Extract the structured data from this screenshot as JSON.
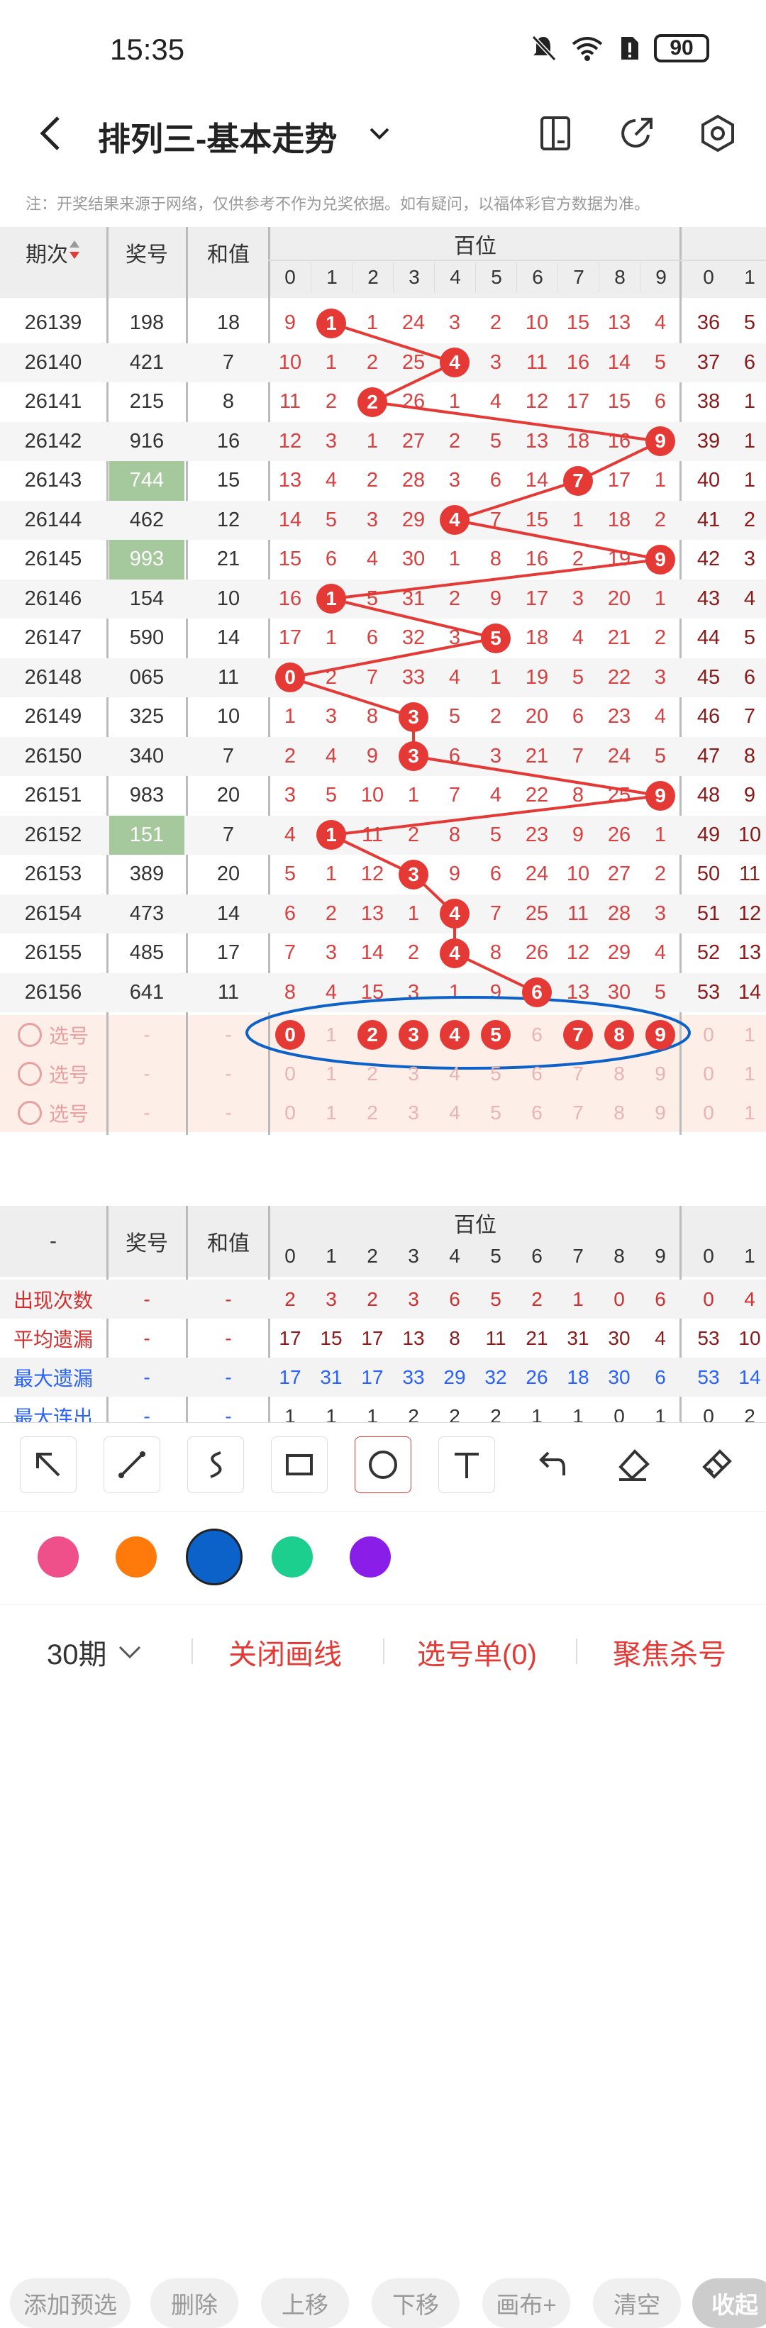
{
  "status": {
    "time": "15:35",
    "battery": "90"
  },
  "header": {
    "title": "排列三-基本走势"
  },
  "note": "注：开奖结果来源于网络，仅供参考不作为兑奖依据。如有疑问，以福体彩官方数据为准。",
  "table": {
    "col_period": "期次",
    "col_number": "奖号",
    "col_sum": "和值",
    "group_hundreds": "百位",
    "digits": [
      "0",
      "1",
      "2",
      "3",
      "4",
      "5",
      "6",
      "7",
      "8",
      "9"
    ],
    "next_digits": [
      "0",
      "1"
    ],
    "rows": [
      {
        "period": "26139",
        "number": "198",
        "sum": "18",
        "hit": 1,
        "highlight": false,
        "miss": [
          "9",
          "1",
          "1",
          "24",
          "3",
          "2",
          "10",
          "15",
          "13",
          "4"
        ],
        "next": [
          "36",
          "5"
        ]
      },
      {
        "period": "26140",
        "number": "421",
        "sum": "7",
        "hit": 4,
        "highlight": false,
        "miss": [
          "10",
          "1",
          "2",
          "25",
          "4",
          "3",
          "11",
          "16",
          "14",
          "5"
        ],
        "next": [
          "37",
          "6"
        ]
      },
      {
        "period": "26141",
        "number": "215",
        "sum": "8",
        "hit": 2,
        "highlight": false,
        "miss": [
          "11",
          "2",
          "2",
          "26",
          "1",
          "4",
          "12",
          "17",
          "15",
          "6"
        ],
        "next": [
          "38",
          "1"
        ]
      },
      {
        "period": "26142",
        "number": "916",
        "sum": "16",
        "hit": 9,
        "highlight": false,
        "miss": [
          "12",
          "3",
          "1",
          "27",
          "2",
          "5",
          "13",
          "18",
          "16",
          "9"
        ],
        "next": [
          "39",
          "1"
        ]
      },
      {
        "period": "26143",
        "number": "744",
        "sum": "15",
        "hit": 7,
        "highlight": true,
        "miss": [
          "13",
          "4",
          "2",
          "28",
          "3",
          "6",
          "14",
          "7",
          "17",
          "1"
        ],
        "next": [
          "40",
          "1"
        ]
      },
      {
        "period": "26144",
        "number": "462",
        "sum": "12",
        "hit": 4,
        "highlight": false,
        "miss": [
          "14",
          "5",
          "3",
          "29",
          "4",
          "7",
          "15",
          "1",
          "18",
          "2"
        ],
        "next": [
          "41",
          "2"
        ]
      },
      {
        "period": "26145",
        "number": "993",
        "sum": "21",
        "hit": 9,
        "highlight": true,
        "miss": [
          "15",
          "6",
          "4",
          "30",
          "1",
          "8",
          "16",
          "2",
          "19",
          "9"
        ],
        "next": [
          "42",
          "3"
        ]
      },
      {
        "period": "26146",
        "number": "154",
        "sum": "10",
        "hit": 1,
        "highlight": false,
        "miss": [
          "16",
          "1",
          "5",
          "31",
          "2",
          "9",
          "17",
          "3",
          "20",
          "1"
        ],
        "next": [
          "43",
          "4"
        ]
      },
      {
        "period": "26147",
        "number": "590",
        "sum": "14",
        "hit": 5,
        "highlight": false,
        "miss": [
          "17",
          "1",
          "6",
          "32",
          "3",
          "5",
          "18",
          "4",
          "21",
          "2"
        ],
        "next": [
          "44",
          "5"
        ]
      },
      {
        "period": "26148",
        "number": "065",
        "sum": "11",
        "hit": 0,
        "highlight": false,
        "miss": [
          "0",
          "2",
          "7",
          "33",
          "4",
          "1",
          "19",
          "5",
          "22",
          "3"
        ],
        "next": [
          "45",
          "6"
        ]
      },
      {
        "period": "26149",
        "number": "325",
        "sum": "10",
        "hit": 3,
        "highlight": false,
        "miss": [
          "1",
          "3",
          "8",
          "3",
          "5",
          "2",
          "20",
          "6",
          "23",
          "4"
        ],
        "next": [
          "46",
          "7"
        ]
      },
      {
        "period": "26150",
        "number": "340",
        "sum": "7",
        "hit": 3,
        "highlight": false,
        "miss": [
          "2",
          "4",
          "9",
          "3",
          "6",
          "3",
          "21",
          "7",
          "24",
          "5"
        ],
        "next": [
          "47",
          "8"
        ]
      },
      {
        "period": "26151",
        "number": "983",
        "sum": "20",
        "hit": 9,
        "highlight": false,
        "miss": [
          "3",
          "5",
          "10",
          "1",
          "7",
          "4",
          "22",
          "8",
          "25",
          "9"
        ],
        "next": [
          "48",
          "9"
        ]
      },
      {
        "period": "26152",
        "number": "151",
        "sum": "7",
        "hit": 1,
        "highlight": true,
        "miss": [
          "4",
          "1",
          "11",
          "2",
          "8",
          "5",
          "23",
          "9",
          "26",
          "1"
        ],
        "next": [
          "49",
          "10"
        ]
      },
      {
        "period": "26153",
        "number": "389",
        "sum": "20",
        "hit": 3,
        "highlight": false,
        "miss": [
          "5",
          "1",
          "12",
          "3",
          "9",
          "6",
          "24",
          "10",
          "27",
          "2"
        ],
        "next": [
          "50",
          "11"
        ]
      },
      {
        "period": "26154",
        "number": "473",
        "sum": "14",
        "hit": 4,
        "highlight": false,
        "miss": [
          "6",
          "2",
          "13",
          "1",
          "4",
          "7",
          "25",
          "11",
          "28",
          "3"
        ],
        "next": [
          "51",
          "12"
        ]
      },
      {
        "period": "26155",
        "number": "485",
        "sum": "17",
        "hit": 4,
        "highlight": false,
        "miss": [
          "7",
          "3",
          "14",
          "2",
          "4",
          "8",
          "26",
          "12",
          "29",
          "4"
        ],
        "next": [
          "52",
          "13"
        ]
      },
      {
        "period": "26156",
        "number": "641",
        "sum": "11",
        "hit": 6,
        "highlight": false,
        "miss": [
          "8",
          "4",
          "15",
          "3",
          "1",
          "9",
          "6",
          "13",
          "30",
          "5"
        ],
        "next": [
          "53",
          "14"
        ]
      }
    ],
    "pick_rows": [
      {
        "label": "选号",
        "number": "-",
        "sum": "-",
        "selected": [
          0,
          2,
          3,
          4,
          5,
          7,
          8,
          9
        ]
      },
      {
        "label": "选号",
        "number": "-",
        "sum": "-",
        "selected": []
      },
      {
        "label": "选号",
        "number": "-",
        "sum": "-",
        "selected": []
      }
    ]
  },
  "actions": [
    "添加预选",
    "删除",
    "上移",
    "下移",
    "画布+",
    "清空",
    "收起"
  ],
  "stats": {
    "col_first": "-",
    "col_number": "奖号",
    "col_sum": "和值",
    "group_hundreds": "百位",
    "rows": [
      {
        "label": "出现次数",
        "label_color": "#d32f2f",
        "number": "-",
        "sum": "-",
        "values": [
          "2",
          "3",
          "2",
          "3",
          "6",
          "5",
          "2",
          "1",
          "0",
          "6"
        ],
        "next": [
          "0",
          "4"
        ],
        "color": "#d32f2f"
      },
      {
        "label": "平均遗漏",
        "label_color": "#d32f2f",
        "number": "-",
        "sum": "-",
        "values": [
          "17",
          "15",
          "17",
          "13",
          "8",
          "11",
          "21",
          "31",
          "30",
          "4"
        ],
        "next": [
          "53",
          "10"
        ],
        "color": "#8b1a1a"
      },
      {
        "label": "最大遗漏",
        "label_color": "#2962ff",
        "number": "-",
        "sum": "-",
        "values": [
          "17",
          "31",
          "17",
          "33",
          "29",
          "32",
          "26",
          "18",
          "30",
          "6"
        ],
        "next": [
          "53",
          "14"
        ],
        "color": "#2962ff"
      },
      {
        "label": "最大连出",
        "label_color": "#2962ff",
        "number": "-",
        "sum": "-",
        "values": [
          "1",
          "1",
          "1",
          "2",
          "2",
          "2",
          "1",
          "1",
          "0",
          "1"
        ],
        "next": [
          "0",
          "2"
        ],
        "color": "#333"
      }
    ]
  },
  "palette": [
    "#f0508a",
    "#ff7a0a",
    "#0d62c9",
    "#1ccf8e",
    "#8a1ee8"
  ],
  "bottom": {
    "periods": "30期",
    "close_lines": "关闭画线",
    "pick_list": "选号单(0)",
    "focus_kill": "聚焦杀号"
  }
}
